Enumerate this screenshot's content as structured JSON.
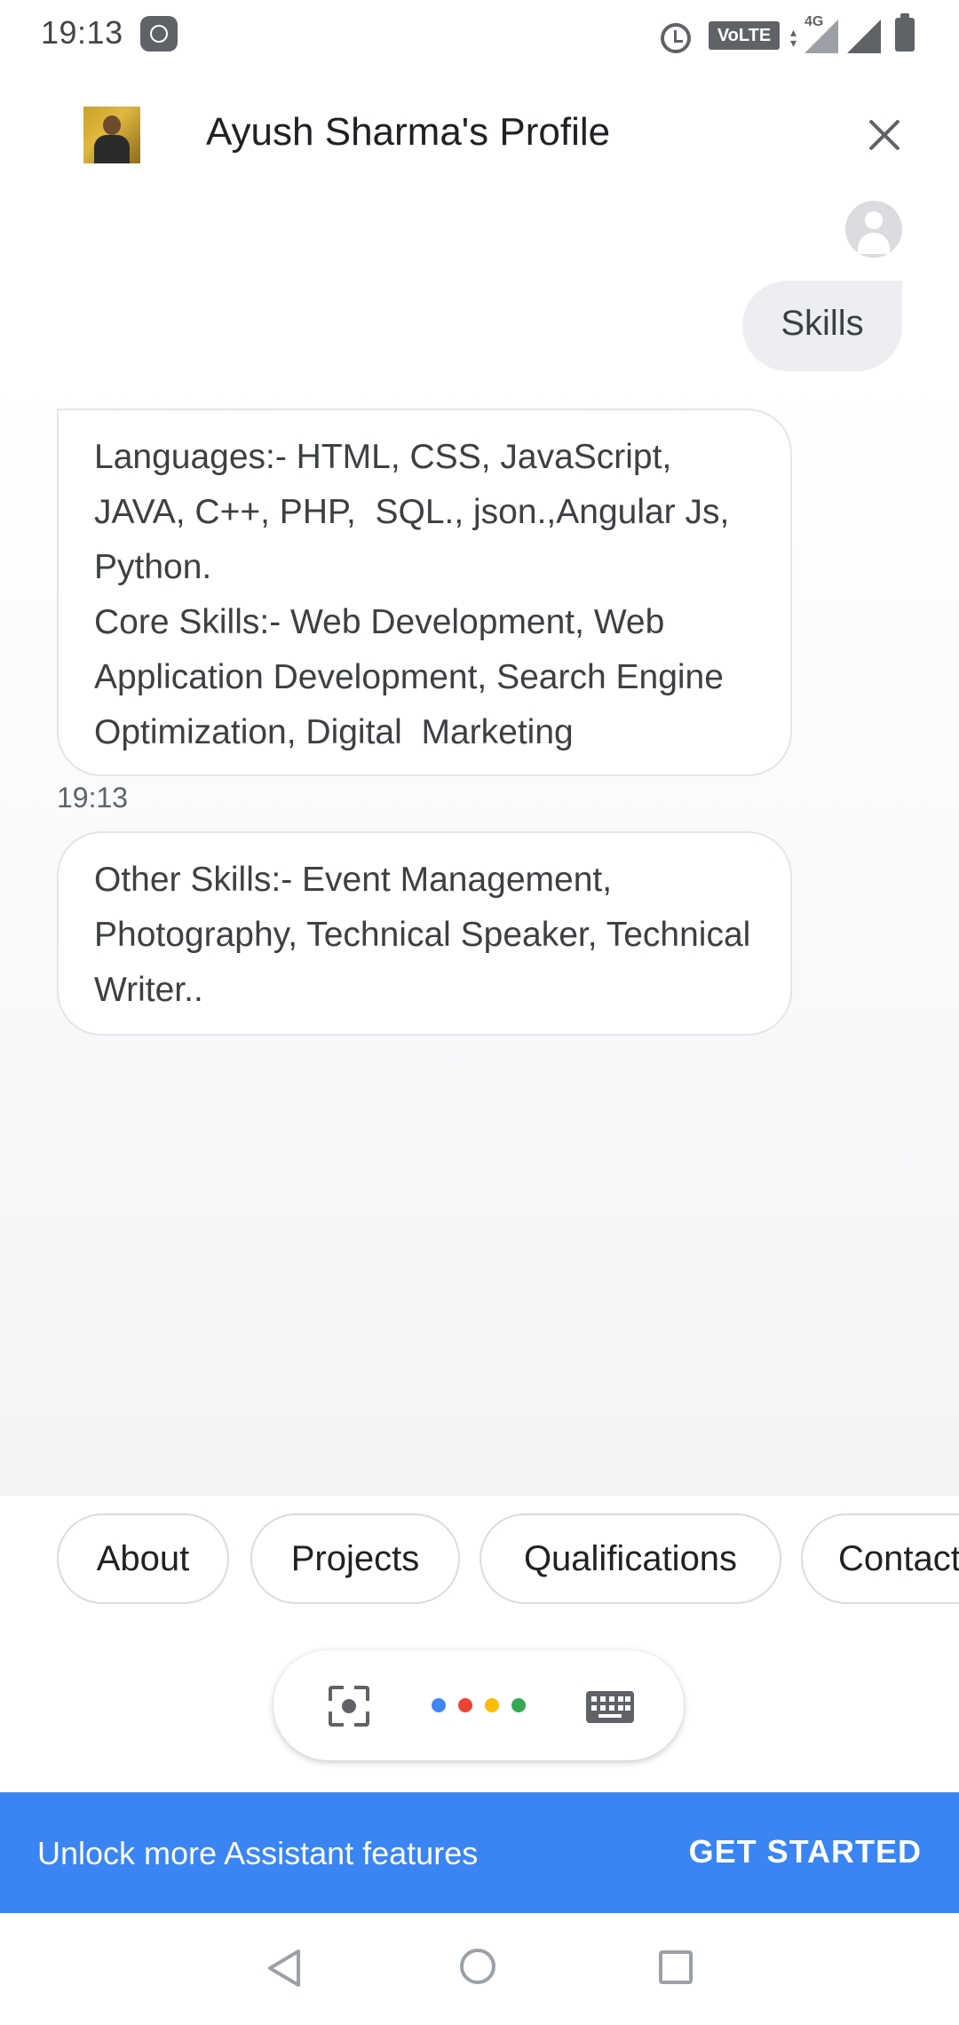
{
  "status_bar": {
    "time": "19:13",
    "volte_label": "VoLTE",
    "network_label": "4G",
    "icons": [
      "mi-icon",
      "alarm-icon",
      "volte-icon",
      "data-icon",
      "signal-icon",
      "battery-icon"
    ]
  },
  "header": {
    "title": "Ayush Sharma's Profile",
    "avatar_icon": "profile-photo",
    "close_icon": "close-icon"
  },
  "conversation": {
    "user_message": "Skills",
    "bot_message_1": "Languages:- HTML, CSS, JavaScript, JAVA, C++, PHP,  SQL., json.,Angular Js, Python.\nCore Skills:- Web Development, Web Application Development, Search Engine Optimization, Digital  Marketing",
    "timestamp": "19:13",
    "bot_message_2": "Other Skills:- Event Management, Photography, Technical Speaker, Technical Writer.."
  },
  "suggestions": [
    {
      "label": "About"
    },
    {
      "label": "Projects"
    },
    {
      "label": "Qualifications"
    },
    {
      "label": "Contact"
    }
  ],
  "input_bar": {
    "icons": [
      "lens-icon",
      "assistant-dots-icon",
      "keyboard-icon"
    ],
    "dot_colors": [
      "#4285f4",
      "#ea4335",
      "#fbbc05",
      "#34a853"
    ]
  },
  "banner": {
    "text": "Unlock more Assistant features",
    "button_label": "GET STARTED",
    "background": "#3a85f3"
  },
  "nav_bar": {
    "icons": [
      "back-icon",
      "home-icon",
      "recents-icon"
    ]
  }
}
